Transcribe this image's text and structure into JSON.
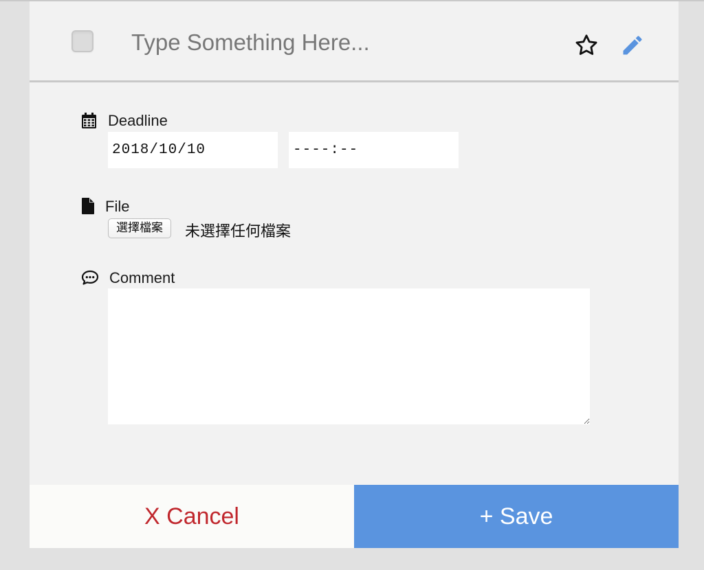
{
  "header": {
    "title_placeholder": "Type Something Here...",
    "completed": false,
    "starred": false
  },
  "deadline": {
    "label": "Deadline",
    "date_value": "2018/10/10",
    "time_value": "----:--"
  },
  "file": {
    "label": "File",
    "button_label": "選擇檔案",
    "status_text": "未選擇任何檔案"
  },
  "comment": {
    "label": "Comment",
    "value": ""
  },
  "footer": {
    "cancel_label": "X Cancel",
    "save_label": "+ Save"
  },
  "colors": {
    "accent": "#5a94df",
    "cancel": "#c0272d",
    "panel": "#f2f2f2",
    "backdrop": "#e1e1e1"
  },
  "icons": {
    "checkbox": "checkbox-icon",
    "star": "star-outline-icon",
    "edit": "pencil-icon",
    "deadline": "calendar-icon",
    "file": "file-icon",
    "comment": "comment-icon"
  }
}
